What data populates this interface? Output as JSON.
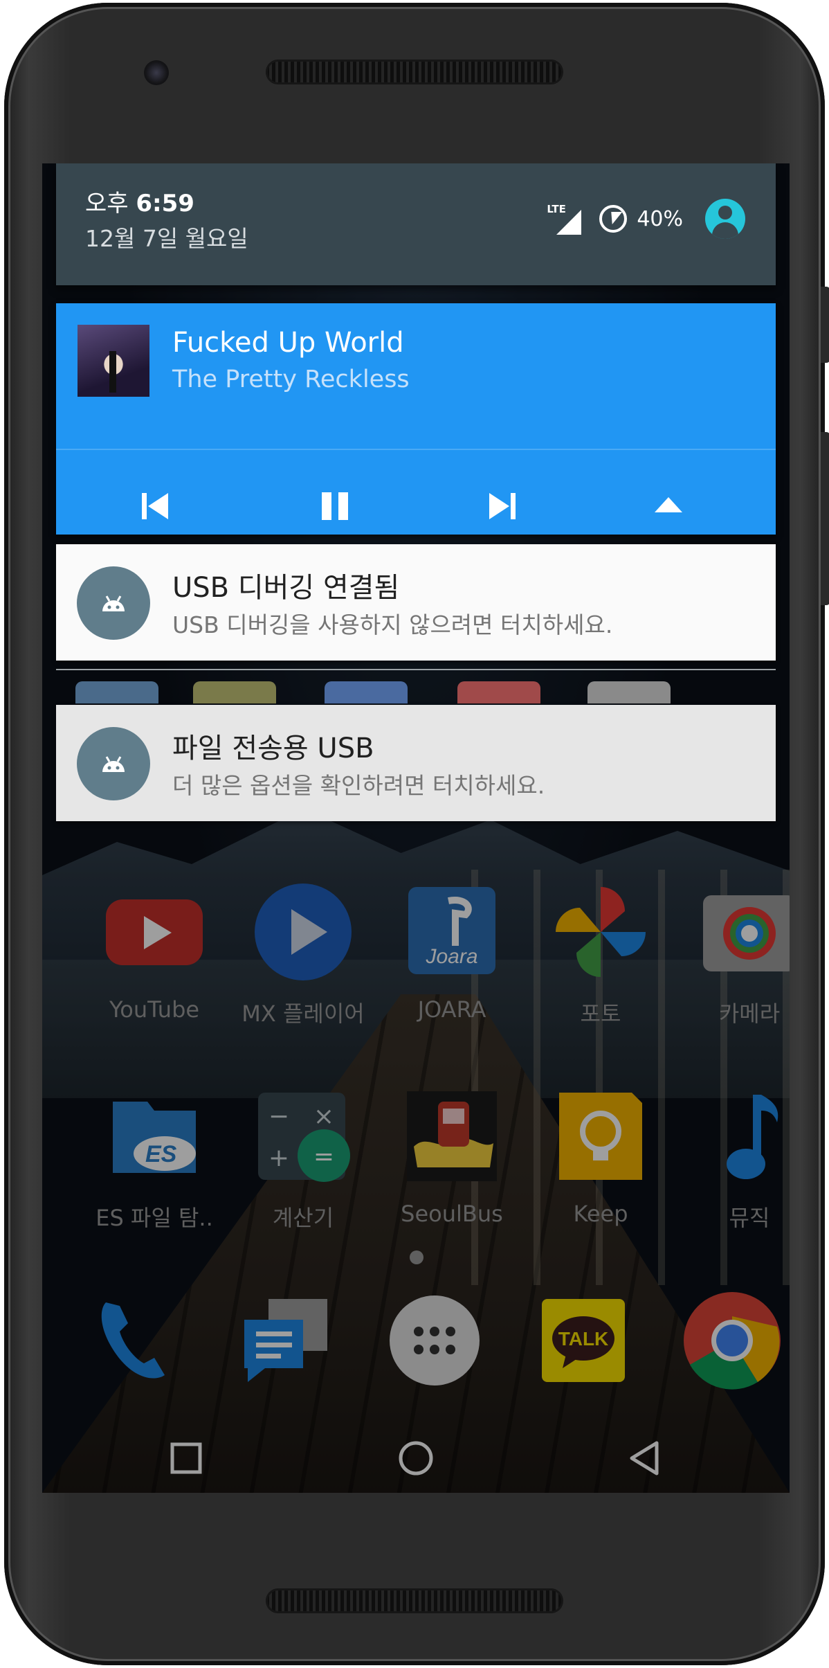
{
  "status": {
    "time_prefix": "오후",
    "time": "6:59",
    "date": "12월 7일 월요일",
    "network": "LTE",
    "battery": "40%"
  },
  "media": {
    "title": "Fucked Up World",
    "artist": "The Pretty Reckless",
    "controls": [
      "previous-icon",
      "pause-icon",
      "next-icon",
      "collapse-icon"
    ]
  },
  "notifications": [
    {
      "title": "USB 디버깅 연결됨",
      "text": "USB 디버깅을 사용하지 않으려면 터치하세요."
    },
    {
      "title": "파일 전송용 USB",
      "text": "더 많은 옵션을 확인하려면 터치하세요."
    }
  ],
  "apps_row1": [
    {
      "label": "YouTube",
      "color": "#c4302b"
    },
    {
      "label": "MX 플레이어",
      "color": "#1f5fbf"
    },
    {
      "label": "JOARA",
      "color": "#2c6fb3"
    },
    {
      "label": "포토",
      "color": "#f4b400"
    },
    {
      "label": "카메라",
      "color": "#9e9e9e"
    }
  ],
  "apps_row2": [
    {
      "label": "ES 파일 탐..",
      "color": "#2a7fc9"
    },
    {
      "label": "계산기",
      "color": "#37474f"
    },
    {
      "label": "SeoulBus",
      "color": "#e53935"
    },
    {
      "label": "Keep",
      "color": "#f4b400"
    },
    {
      "label": "뮤직",
      "color": "#1e88e5"
    }
  ],
  "dock": [
    "phone-icon",
    "messenger-icon",
    "app-drawer-icon",
    "kakaotalk-icon",
    "chrome-icon"
  ],
  "dock_talk_label": "TALK",
  "navbar": [
    "recents-button",
    "home-button",
    "back-button"
  ]
}
